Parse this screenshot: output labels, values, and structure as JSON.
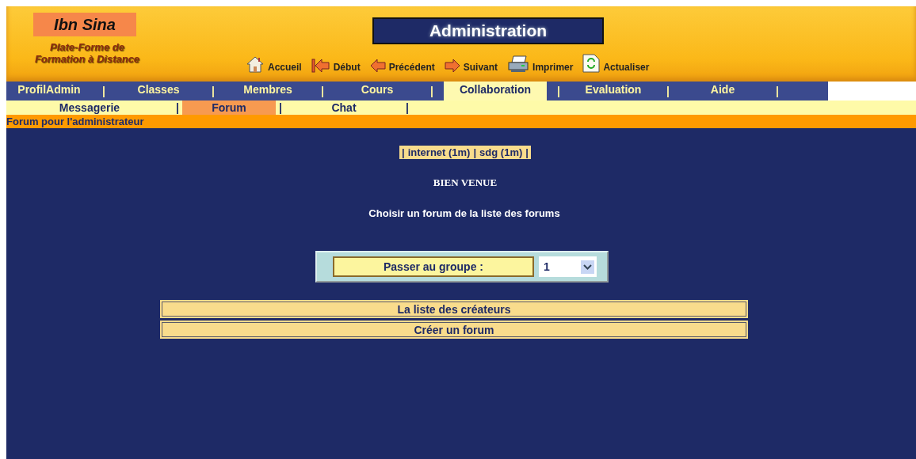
{
  "header": {
    "logo": "Ibn Sina",
    "tagline_1": "Plate-Forme de",
    "tagline_2": "Formation à Distance",
    "title": "Administration",
    "toolbar": [
      {
        "kind": "home",
        "label": "Accueil"
      },
      {
        "kind": "first",
        "label": "Début"
      },
      {
        "kind": "prev",
        "label": "Précédent"
      },
      {
        "kind": "next",
        "label": "Suivant"
      },
      {
        "kind": "print",
        "label": "Imprimer"
      },
      {
        "kind": "refresh",
        "label": "Actualiser"
      }
    ]
  },
  "separator": "|",
  "tabs": [
    {
      "label": "ProfilAdmin",
      "selected": false
    },
    {
      "label": "Classes",
      "selected": false
    },
    {
      "label": "Membres",
      "selected": false
    },
    {
      "label": "Cours",
      "selected": false
    },
    {
      "label": "Collaboration",
      "selected": true
    },
    {
      "label": "Evaluation",
      "selected": false
    },
    {
      "label": "Aide",
      "selected": false
    }
  ],
  "subtabs": [
    {
      "label": "Messagerie",
      "selected": false
    },
    {
      "label": "Forum",
      "selected": true
    },
    {
      "label": "Chat",
      "selected": false
    }
  ],
  "section_title": "Forum pour l'administrateur",
  "forums": [
    "internet (1m)",
    "sdg (1m)"
  ],
  "welcome": "BIEN VENUE",
  "instruction": "Choisir un forum de la liste des forums",
  "group": {
    "label": "Passer au groupe :",
    "value": "1"
  },
  "buttons": [
    "La liste des créateurs",
    "Créer un forum"
  ]
}
